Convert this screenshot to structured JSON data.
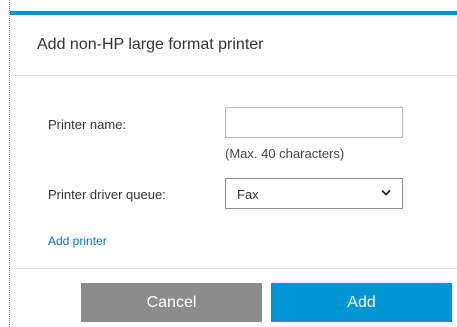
{
  "dialog": {
    "title": "Add non-HP large format printer",
    "accent_color": "#0096d6"
  },
  "form": {
    "printer_name": {
      "label": "Printer name:",
      "value": "",
      "hint": "(Max. 40 characters)"
    },
    "driver_queue": {
      "label": "Printer driver queue:",
      "selected": "Fax",
      "icon": "chevron-down-icon"
    },
    "add_printer_link": "Add printer"
  },
  "footer": {
    "cancel_label": "Cancel",
    "add_label": "Add",
    "cancel_color": "#8c8c8c",
    "add_color": "#0096d6"
  }
}
